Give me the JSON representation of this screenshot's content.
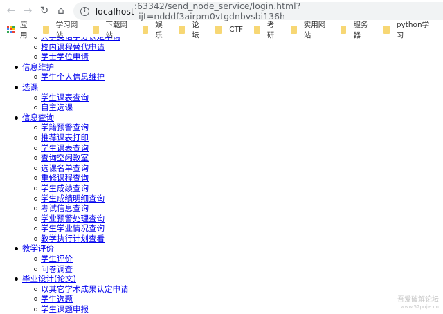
{
  "browser": {
    "url_host": "localhost",
    "url_rest": ":63342/send_node_service/login.html?_ijt=ndddf3airpm0vtgdnbvsbi136h"
  },
  "bookmarks": {
    "apps_label": "应用",
    "items": [
      "学习网站",
      "下载网站",
      "娱乐",
      "论坛",
      "CTF",
      "考研",
      "实用网站",
      "服务器",
      "python学习"
    ]
  },
  "menu": [
    {
      "label": null,
      "children": [
        "大学英语学分认定申请",
        "校内课程替代申请",
        "学士学位申请"
      ]
    },
    {
      "label": "信息维护",
      "children": [
        "学生个人信息维护"
      ]
    },
    {
      "label": "选课",
      "children": [
        "学生课表查询",
        "自主选课"
      ]
    },
    {
      "label": "信息查询",
      "children": [
        "学籍预警查询",
        "推荐课表打印",
        "学生课表查询",
        "查询空闲教室",
        "选课名单查询",
        "重修课程查询",
        "学生成绩查询",
        "学生成绩明细查询",
        "考试信息查询",
        "学业预警处理查询",
        "学生学业情况查询",
        "教学执行计划查看"
      ]
    },
    {
      "label": "教学评价",
      "children": [
        "学生评价",
        "问卷调查"
      ]
    },
    {
      "label": "毕业设计(论文)",
      "children": [
        "以其它学术成果认定申请",
        "学生选题",
        "学生课题申报"
      ]
    }
  ],
  "watermark": {
    "title": "吾爱破解论坛",
    "url": "www.52pojie.cn"
  }
}
